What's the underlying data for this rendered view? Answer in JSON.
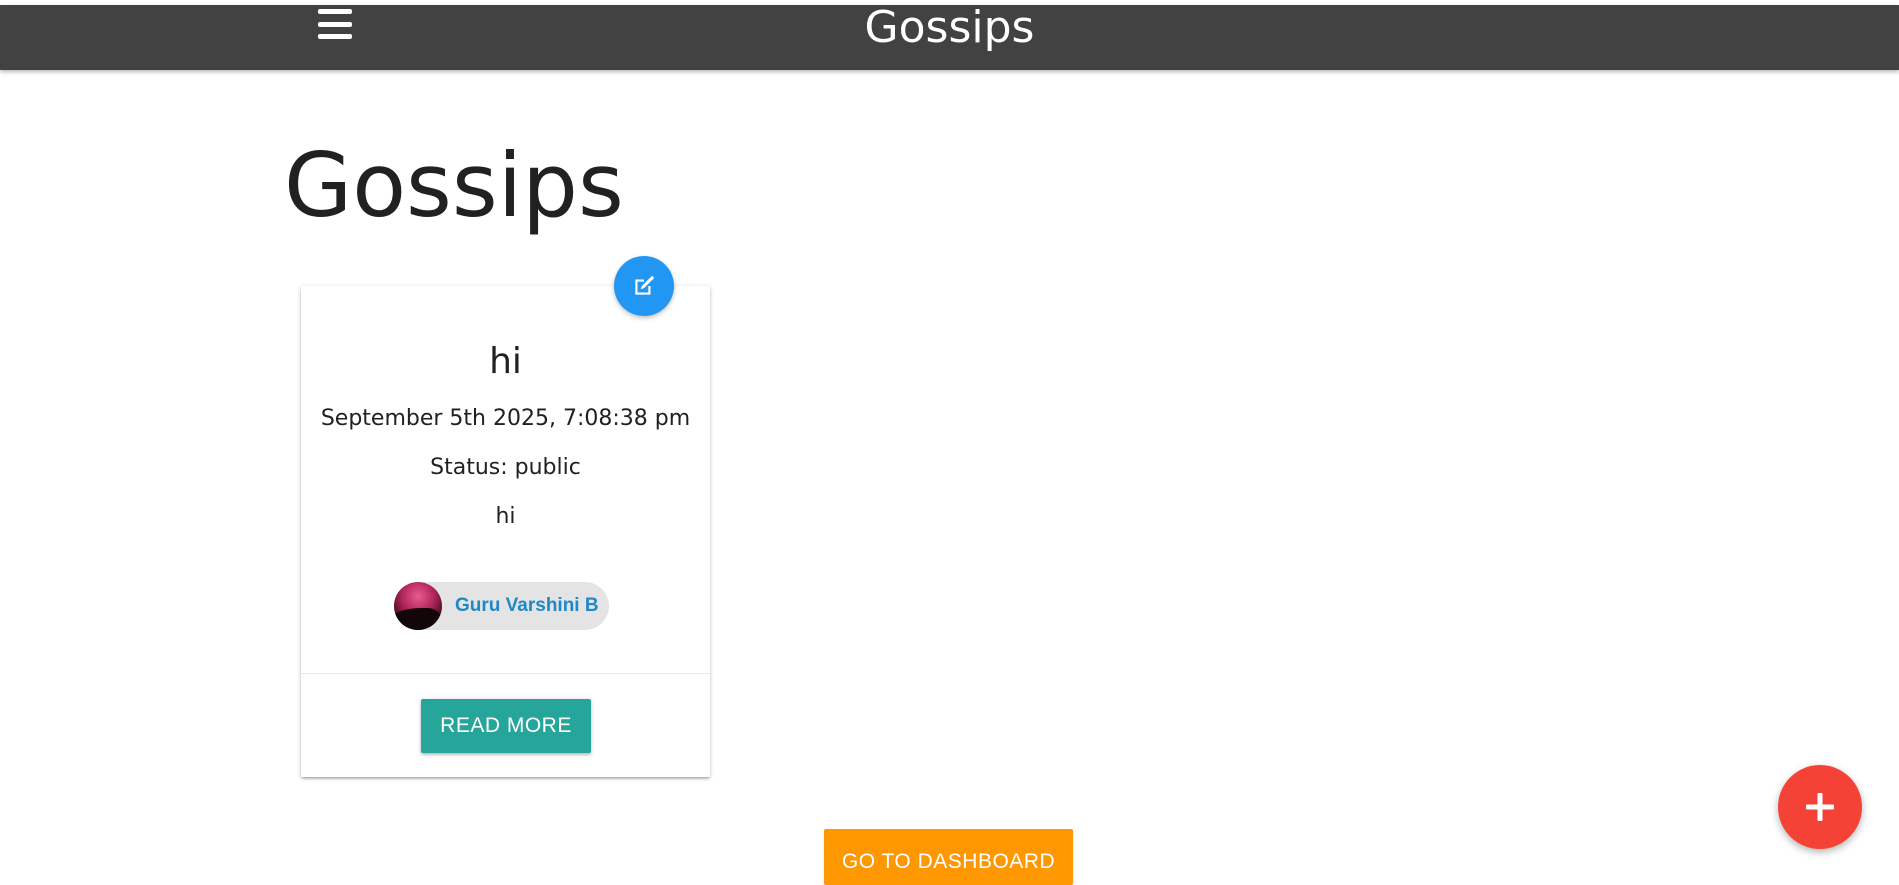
{
  "navbar": {
    "brand": "Gossips",
    "menu_icon": "hamburger-menu-icon"
  },
  "page": {
    "title": "Gossips"
  },
  "story_card": {
    "title": "hi",
    "date": "September 5th 2025, 7:08:38 pm",
    "status": "Status: public",
    "body": "hi",
    "author": "Guru Varshini B",
    "edit_icon": "edit-icon",
    "read_more_label": "READ MORE"
  },
  "actions": {
    "dashboard_label": "GO TO DASHBOARD",
    "add_icon": "plus-icon"
  },
  "colors": {
    "navbar": "#424242",
    "edit_fab": "#2196f3",
    "read_more": "#26a69a",
    "dashboard": "#ff9800",
    "add_fab": "#f44336",
    "author_link": "#1e88c8"
  }
}
